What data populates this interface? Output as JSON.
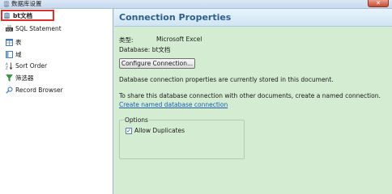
{
  "window": {
    "title": "数据库设置",
    "close_symbol": "✕"
  },
  "sidebar": {
    "items": [
      {
        "label": "bt文档",
        "icon": "database-icon"
      },
      {
        "label": "SQL Statement",
        "icon": "sql-icon"
      },
      {
        "label": "表",
        "icon": "table-icon"
      },
      {
        "label": "域",
        "icon": "field-icon"
      },
      {
        "label": "Sort Order",
        "icon": "sort-icon"
      },
      {
        "label": "筛选器",
        "icon": "filter-icon"
      },
      {
        "label": "Record Browser",
        "icon": "search-icon"
      }
    ]
  },
  "main": {
    "title": "Connection Properties",
    "type_label": "类型:",
    "type_value": "Microsoft Excel",
    "database_line": "Database: bt文档",
    "configure_button": "Configure Connection...",
    "stored_text": "Database connection properties are currently stored in this document.",
    "share_text": "To share this database connection with other documents, create a named connection.",
    "create_link": "Create named database connection",
    "options": {
      "legend": "Options",
      "allow_duplicates_label": "Allow Duplicates",
      "allow_duplicates_checked": true,
      "check_mark": "✓"
    }
  },
  "colors": {
    "heading_text": "#2f5f8a",
    "link": "#1a5fb4",
    "panel_bg": "#d4ecd1",
    "selection_border": "#e0302a"
  }
}
